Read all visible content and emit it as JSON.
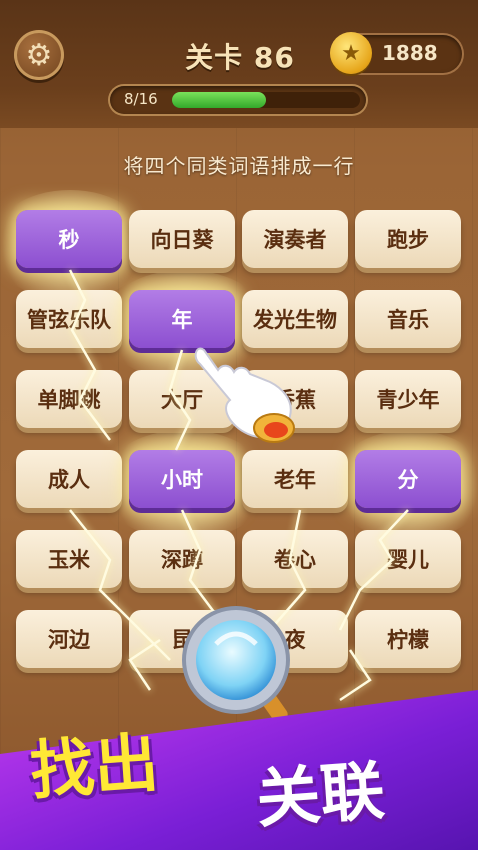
{
  "header": {
    "settings_icon": "gear-icon",
    "level_label": "关卡 86",
    "coins_icon": "star-coin-icon",
    "coins_value": "1888",
    "progress_text": "8/16",
    "progress_fraction": 0.5
  },
  "instruction": "将四个同类词语排成一行",
  "grid": [
    [
      "秒",
      "向日葵",
      "演奏者",
      "跑步"
    ],
    [
      "管弦乐队",
      "年",
      "发光生物",
      "音乐"
    ],
    [
      "单脚跳",
      "大厅",
      "香蕉",
      "青少年"
    ],
    [
      "成人",
      "小时",
      "老年",
      "分"
    ],
    [
      "玉米",
      "深蹲",
      "卷心",
      "婴儿"
    ],
    [
      "河边",
      "昆",
      "夜",
      "柠檬"
    ]
  ],
  "selected": [
    "0-0",
    "1-1",
    "3-1",
    "3-3"
  ],
  "slogan": {
    "left": "找出",
    "right": "关联"
  },
  "colors": {
    "selected_tile": "#9a5cd8",
    "tile": "#f3e4c8",
    "slogan_yellow": "#ffe835",
    "banner": "#8a2be2"
  }
}
